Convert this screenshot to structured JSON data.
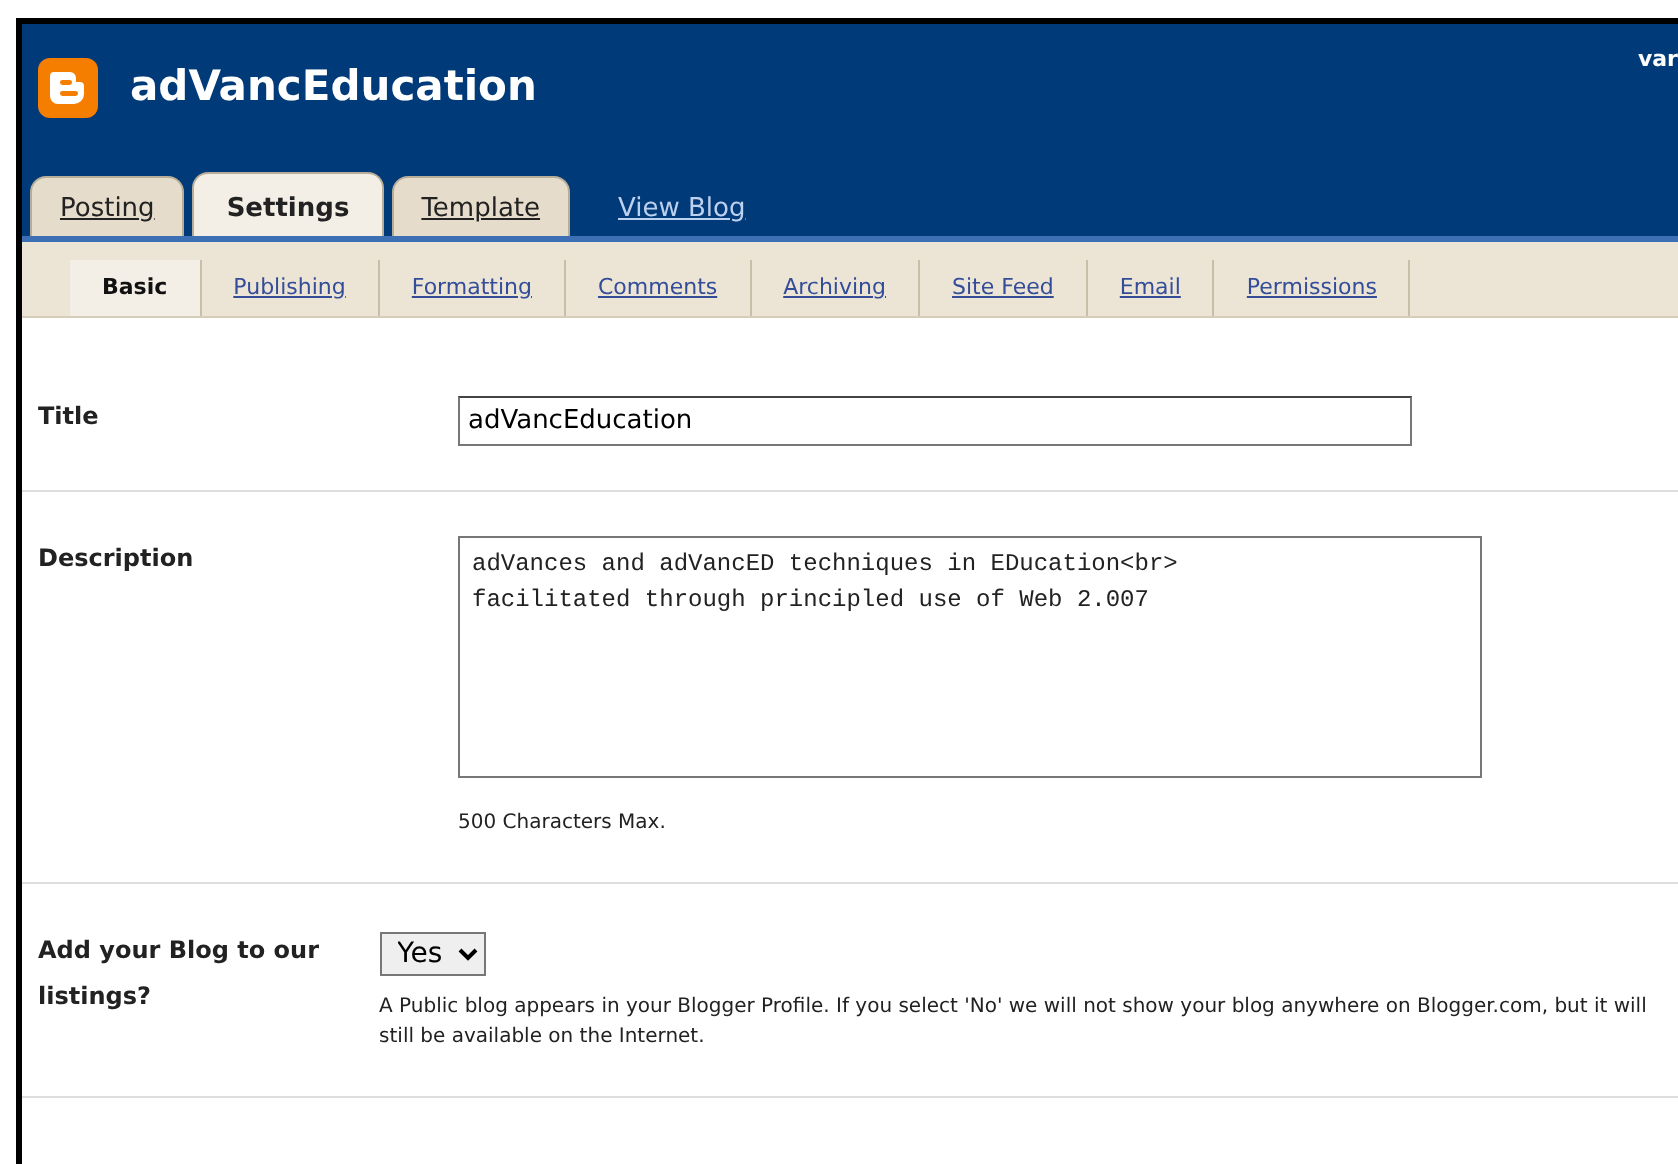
{
  "header": {
    "blog_title": "adVancEducation",
    "user_text": "var"
  },
  "tabs": [
    {
      "label": "Posting",
      "selected": false,
      "kind": "tab"
    },
    {
      "label": "Settings",
      "selected": true,
      "kind": "tab"
    },
    {
      "label": "Template",
      "selected": false,
      "kind": "tab"
    },
    {
      "label": "View Blog",
      "selected": false,
      "kind": "link"
    }
  ],
  "subtabs": [
    {
      "label": "Basic",
      "selected": true
    },
    {
      "label": "Publishing",
      "selected": false
    },
    {
      "label": "Formatting",
      "selected": false
    },
    {
      "label": "Comments",
      "selected": false
    },
    {
      "label": "Archiving",
      "selected": false
    },
    {
      "label": "Site Feed",
      "selected": false
    },
    {
      "label": "Email",
      "selected": false
    },
    {
      "label": "Permissions",
      "selected": false
    }
  ],
  "fields": [
    {
      "kind": "text",
      "label": "Title",
      "value": "adVancEducation"
    },
    {
      "kind": "textarea",
      "label": "Description",
      "value": "adVances and adVancED techniques in EDucation<br>\nfacilitated through principled use of Web 2.007",
      "note": "500 Characters Max."
    },
    {
      "kind": "select",
      "label": "Add your Blog to our listings?",
      "value": "Yes",
      "note": "A Public blog appears in your Blogger Profile. If you select 'No' we will not show your blog anywhere on Blogger.com, but it will still be available on the Internet."
    }
  ]
}
